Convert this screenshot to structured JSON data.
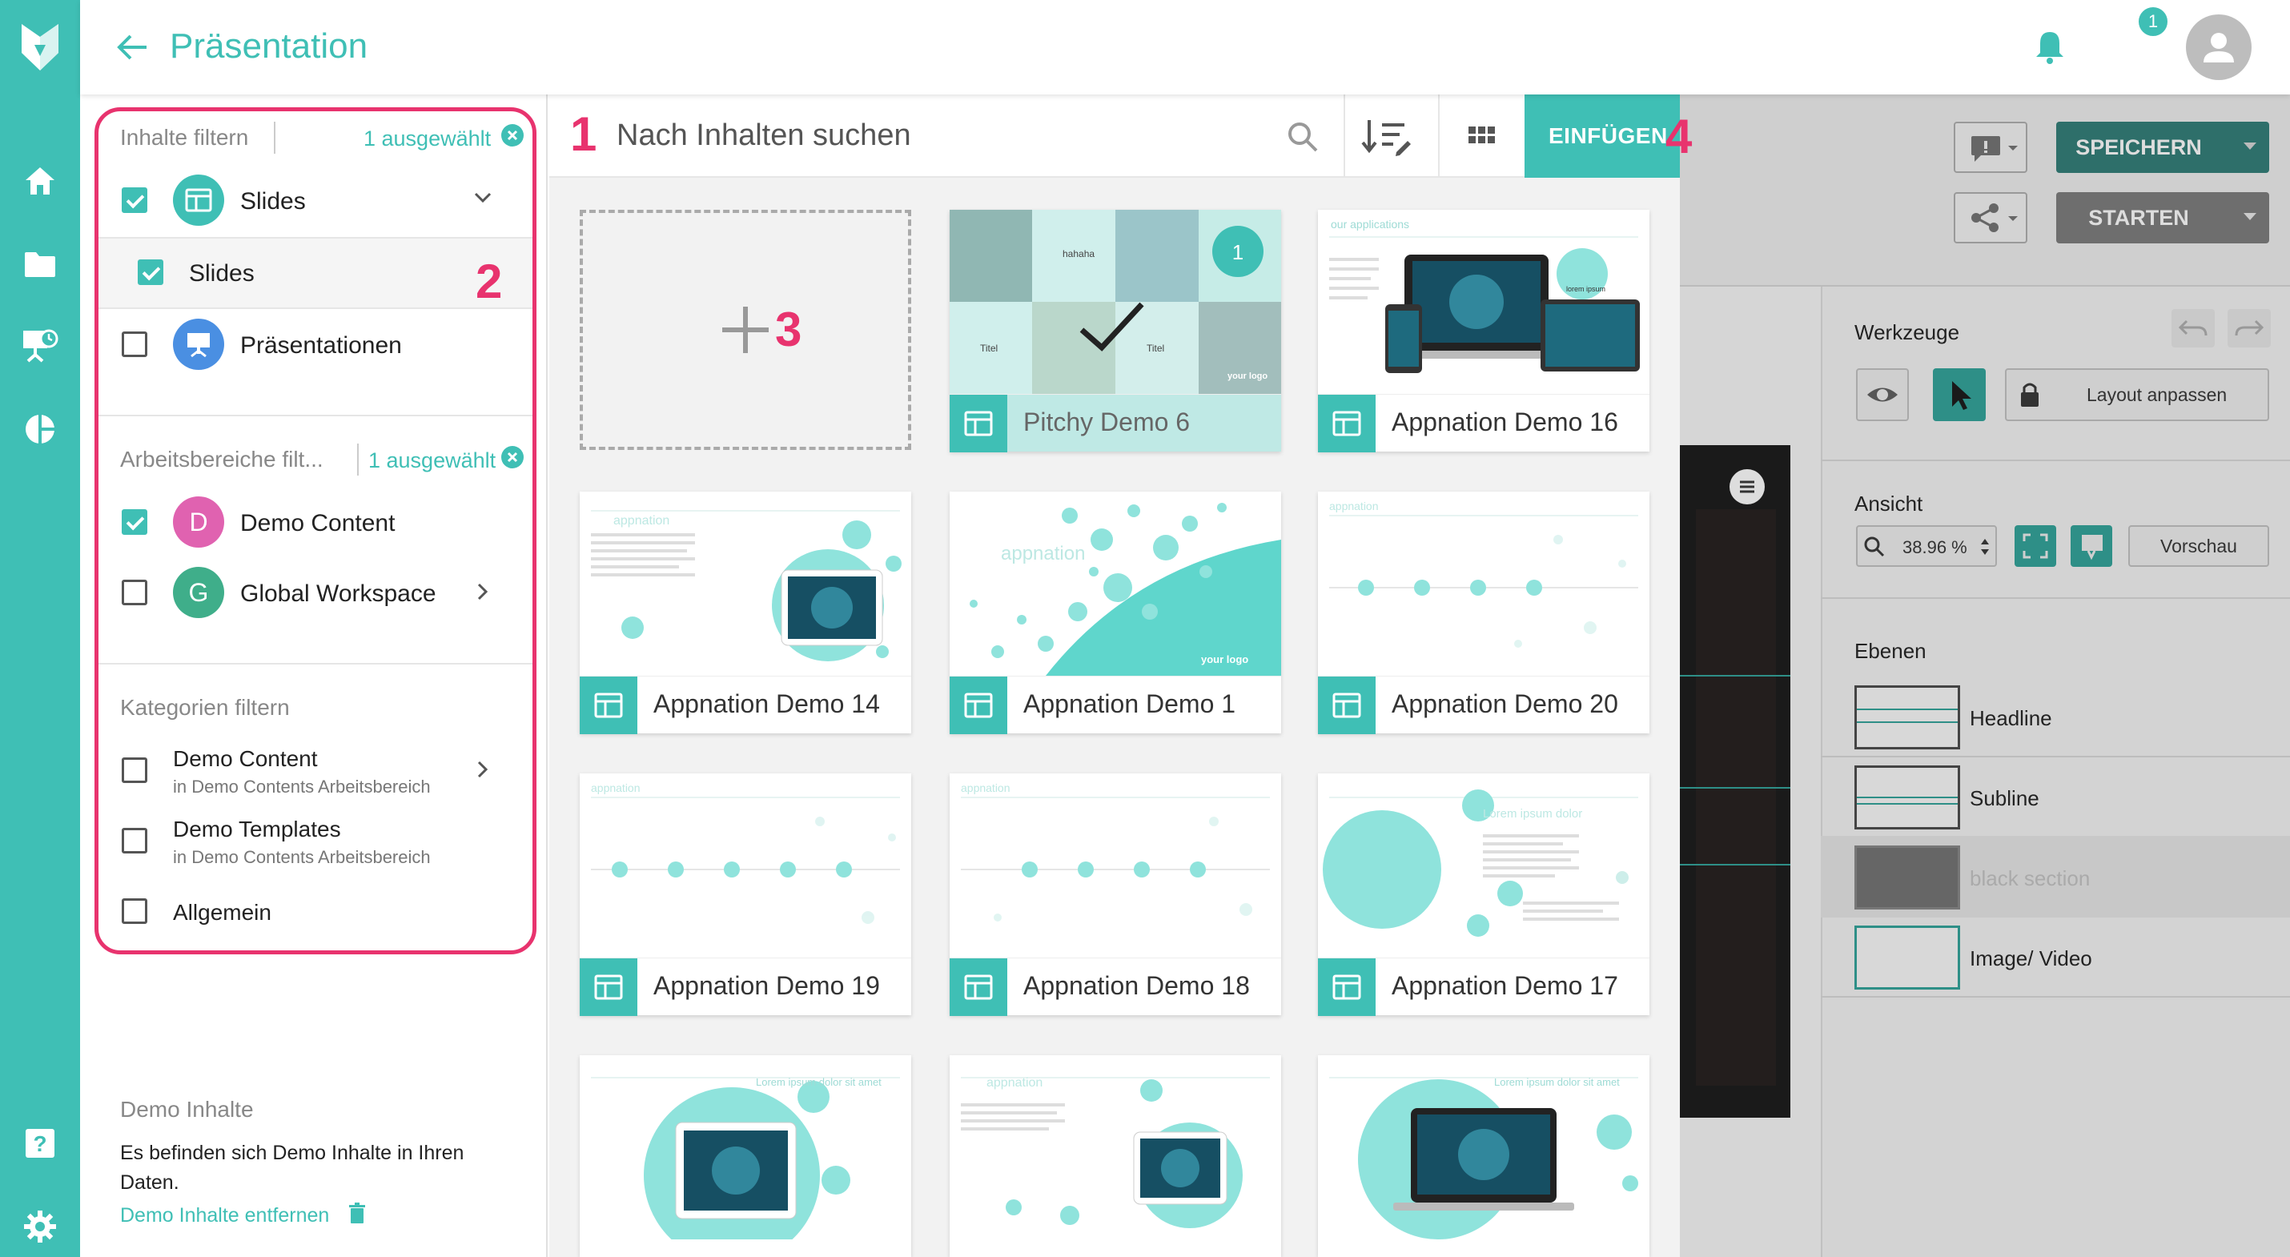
{
  "app": {
    "title": "Präsentation",
    "notification_count": "1"
  },
  "colors": {
    "accent": "#3fbfb5",
    "annotation": "#e8336e",
    "dark_teal": "#2e6f6a"
  },
  "toolbar": {
    "search_placeholder": "Nach Inhalten suchen",
    "insert_label": "EINFÜGEN"
  },
  "filters": {
    "content": {
      "title": "Inhalte filtern",
      "selected": "1 ausgewählt",
      "items": [
        {
          "label": "Slides",
          "checked": true,
          "icon": "slides-icon"
        },
        {
          "label": "Slides",
          "checked": true,
          "sub": true
        },
        {
          "label": "Präsentationen",
          "checked": false,
          "icon": "presentation-icon"
        }
      ]
    },
    "workspaces": {
      "title": "Arbeitsbereiche filt...",
      "selected": "1 ausgewählt",
      "items": [
        {
          "label": "Demo Content",
          "letter": "D",
          "checked": true
        },
        {
          "label": "Global Workspace",
          "letter": "G",
          "checked": false
        }
      ]
    },
    "categories": {
      "title": "Kategorien filtern",
      "items": [
        {
          "label": "Demo Content",
          "sub": "in Demo Contents Arbeitsbereich",
          "checked": false
        },
        {
          "label": "Demo Templates",
          "sub": "in Demo Contents Arbeitsbereich",
          "checked": false
        },
        {
          "label": "Allgemein",
          "checked": false
        }
      ]
    }
  },
  "demo_info": {
    "title": "Demo Inhalte",
    "text": "Es befinden sich Demo Inhalte in Ihren Daten.",
    "link": "Demo Inhalte entfernen"
  },
  "annotations": [
    "1",
    "2",
    "3",
    "4"
  ],
  "cards": [
    {
      "name": "Pitchy Demo 6",
      "selected": true,
      "badge": "1",
      "thumb_texts": [
        "hahaha",
        "Titel",
        "Titel",
        "your logo"
      ]
    },
    {
      "name": "Appnation Demo 16",
      "thumb_texts": [
        "our applications",
        "lorem ipsum"
      ]
    },
    {
      "name": "Appnation Demo 14",
      "thumb_texts": [
        "appnation"
      ]
    },
    {
      "name": "Appnation Demo 1",
      "thumb_texts": [
        "appnation",
        "your logo"
      ]
    },
    {
      "name": "Appnation Demo 20",
      "thumb_texts": [
        "appnation"
      ]
    },
    {
      "name": "Appnation Demo 19",
      "thumb_texts": [
        "appnation"
      ]
    },
    {
      "name": "Appnation Demo 18",
      "thumb_texts": [
        "appnation"
      ]
    },
    {
      "name": "Appnation Demo 17",
      "thumb_texts": [
        "Lorem ipsum dolor"
      ]
    },
    {
      "name": "",
      "thumb_texts": [
        "Lorem ipsum dolor sit amet"
      ]
    },
    {
      "name": "",
      "thumb_texts": [
        "appnation"
      ]
    },
    {
      "name": "",
      "thumb_texts": [
        "Lorem ipsum dolor sit amet"
      ]
    }
  ],
  "editor": {
    "save_label": "SPEICHERN",
    "start_label": "STARTEN",
    "tools_title": "Werkzeuge",
    "layout_label": "Layout anpassen",
    "view_title": "Ansicht",
    "zoom_value": "38.96 %",
    "preview_label": "Vorschau",
    "layers_title": "Ebenen",
    "layers": [
      "Headline",
      "Subline",
      "black section",
      "Image/ Video"
    ]
  }
}
